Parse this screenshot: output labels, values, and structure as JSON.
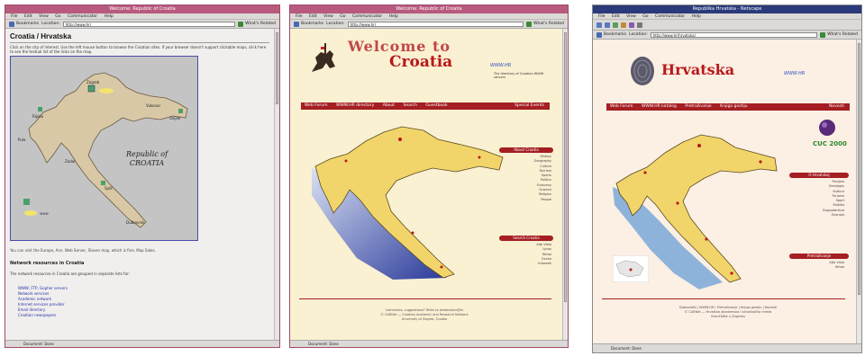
{
  "screenshots": [
    {
      "title": "Welcome: Republic of Croatia",
      "menu": [
        "File",
        "Edit",
        "View",
        "Go",
        "Communicator",
        "Help"
      ],
      "toolbar": {
        "bookmarks": "Bookmarks",
        "location_label": "Location:",
        "url": "http://www.hr/",
        "whats_related": "What's Related"
      },
      "heading": "Croatia / Hrvatska",
      "intro": "Click on the city of interest. Use the left mouse button to browse the Croatian sites. If your browser doesn't support clickable maps, click here to see the textual list of the links on the map.",
      "map_label": "Republic of\nCROATIA",
      "cities": [
        "Zagreb",
        "Rijeka",
        "Osijek",
        "Split",
        "Zadar",
        "Dubrovnik",
        "Pula",
        "Vukovar"
      ],
      "legend_text": "www",
      "below_map": "You can visit the Europe, Ann. Web Server, Slaven map, which is fine, Map Sales.",
      "section_title": "Network resources in Croatia",
      "section_text": "The network resources in Croatia are grouped in separate lists for:",
      "links": [
        "WWW, FTP, Gopher servers",
        "Network services",
        "Academic network",
        "Internet services provider",
        "Email directory",
        "Croatian newspapers"
      ],
      "status": "Document: Done"
    },
    {
      "title": "Welcome: Republic of Croatia",
      "menu": [
        "File",
        "Edit",
        "View",
        "Go",
        "Communicator",
        "Help"
      ],
      "toolbar": {
        "bookmarks": "Bookmarks",
        "location_label": "Location:",
        "url": "http://www.hr/",
        "whats_related": "What's Related"
      },
      "welcome": "Welcome to",
      "croatia": "Croatia",
      "www_hr": "WWW.HR",
      "tagline": "The directory of Croatian WWW servers",
      "nav": [
        "Web Forum",
        "WWW.HR directory",
        "About",
        "Search",
        "Guestbook"
      ],
      "nav_right": "Special Events",
      "right_sections": [
        {
          "title": "About Croatia",
          "links": [
            "History",
            "Geography",
            "Culture",
            "Tourism",
            "Sports",
            "Politics",
            "Economy",
            "Science",
            "Religion",
            "People"
          ]
        },
        {
          "title": "Search Croatia",
          "links": [
            "Alta Vista",
            "Lycos",
            "Yahoo",
            "Excite",
            "Infoseek"
          ]
        }
      ],
      "foot": [
        "Comments, suggestions? Write to webmaster@hr",
        "© CARNet — Croatian Academic and Research Network",
        "University of Zagreb, Croatia"
      ],
      "status": "Document: Done"
    },
    {
      "title": "Republika Hrvatska - Netscape",
      "menu": [
        "File",
        "Edit",
        "View",
        "Go",
        "Communicator",
        "Help"
      ],
      "toolbar": {
        "bookmarks": "Bookmarks",
        "location_label": "Location:",
        "url": "http://www.hr/hrvatska/",
        "whats_related": "What's Related"
      },
      "hrv": "Hrvatska",
      "www_hr": "WWW.HR",
      "nav": [
        "Web Forum",
        "WWW.HR katalog",
        "Pretraživanje",
        "Knjiga gostiju"
      ],
      "nav_right": "Novosti",
      "cuc": "CUC 2000",
      "right_sections": [
        {
          "title": "O Hrvatskoj",
          "links": [
            "Povijest",
            "Zemljopis",
            "Kultura",
            "Turizam",
            "Sport",
            "Politika",
            "Gospodarstvo",
            "Znanost"
          ]
        },
        {
          "title": "Pretraživanje",
          "links": [
            "Alta Vista",
            "Yahoo"
          ]
        }
      ],
      "foot": [
        "Dobrodošli | WWW.HR | Pretraživanje | Knjiga gostiju | Novosti",
        "© CARNet — Hrvatska akademska i istraživačka mreža",
        "Sveučilište u Zagrebu"
      ],
      "status": "Document: Done"
    }
  ],
  "colors": {
    "titlebar": "#b85a7e",
    "navbar": "#a41e22",
    "map_yellow": "#f2d56a",
    "sea_blue": "#5a86cc"
  }
}
